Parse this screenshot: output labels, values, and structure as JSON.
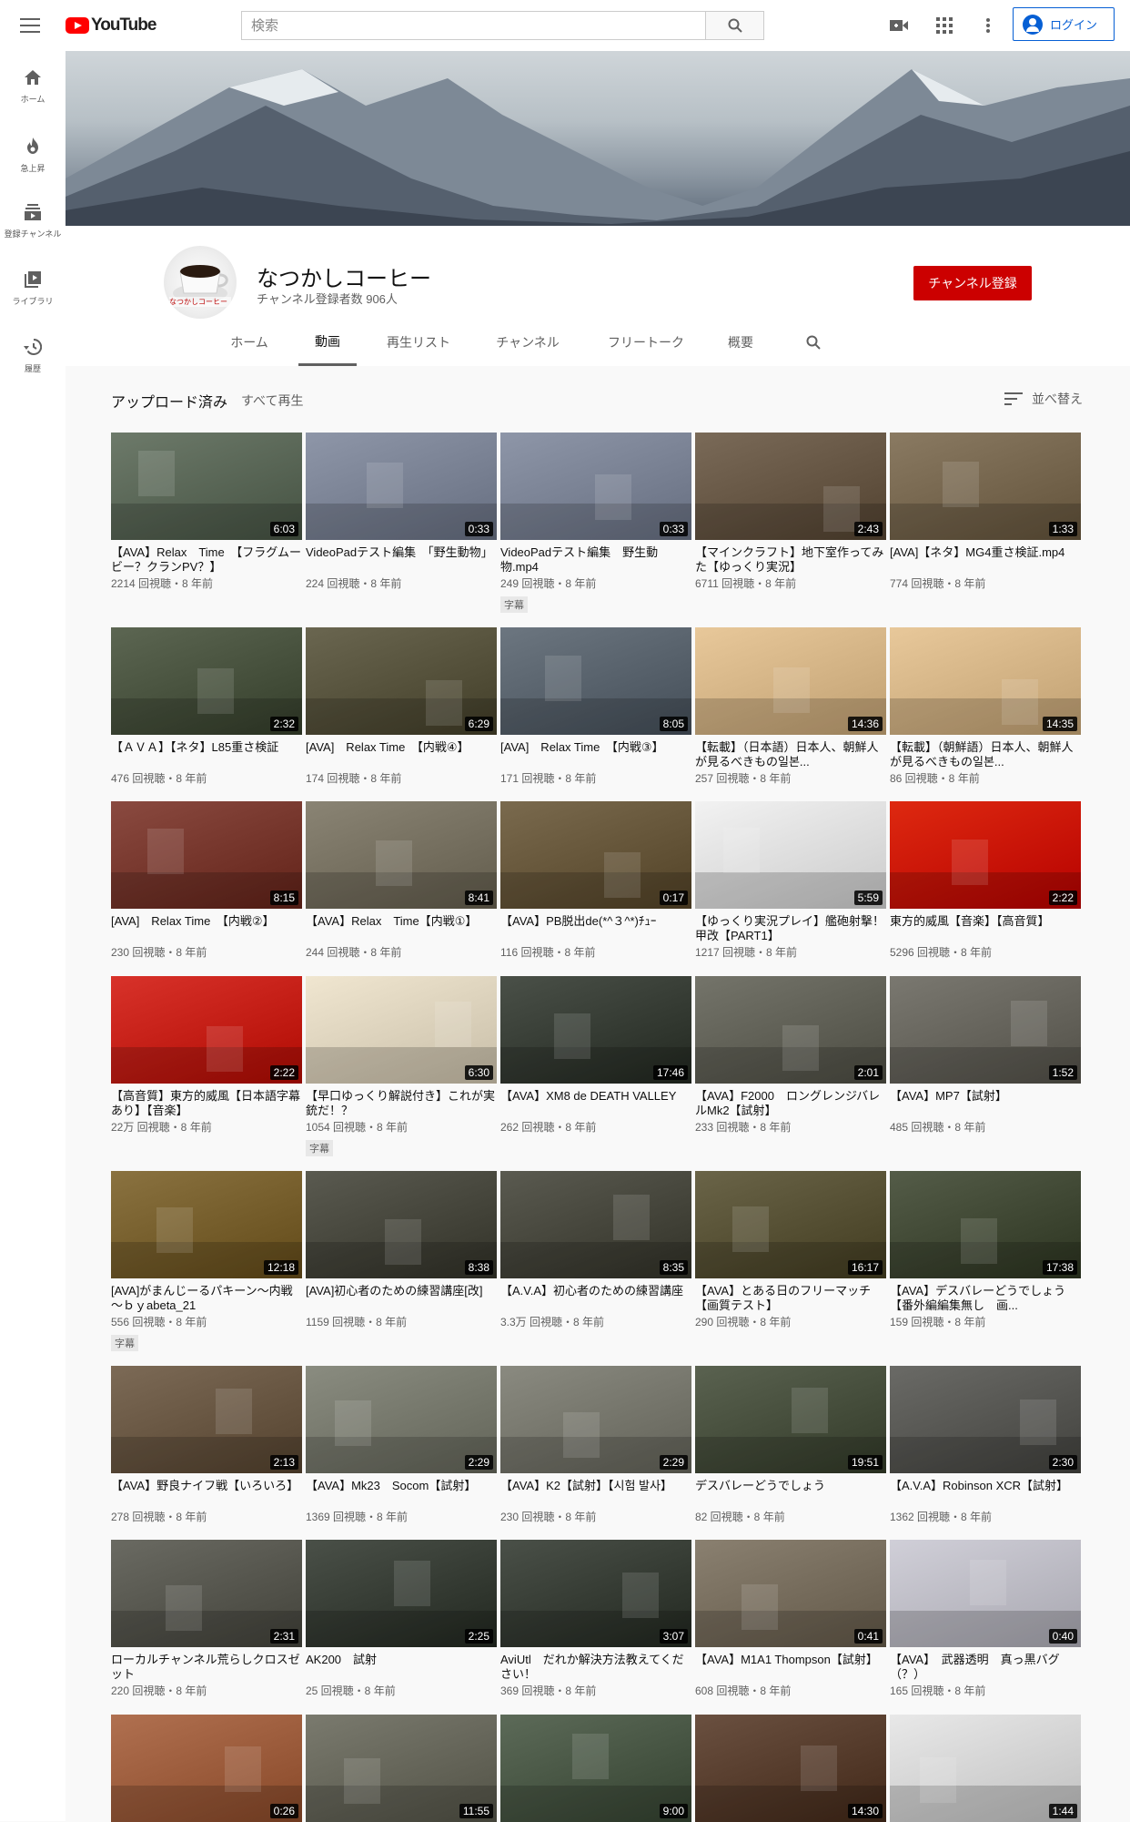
{
  "header": {
    "logo_text": "YouTube",
    "search_placeholder": "検索",
    "login_label": "ログイン"
  },
  "sidebar": [
    {
      "label": "ホーム",
      "icon": "home-icon"
    },
    {
      "label": "急上昇",
      "icon": "fire-icon"
    },
    {
      "label": "登録チャンネル",
      "icon": "subscriptions-icon"
    },
    {
      "label": "ライブラリ",
      "icon": "library-icon"
    },
    {
      "label": "履歴",
      "icon": "history-icon"
    }
  ],
  "channel": {
    "name": "なつかしコーヒー",
    "subscribers": "チャンネル登録者数 906人",
    "subscribe_label": "チャンネル登録",
    "avatar_text": "なつかしコーヒー"
  },
  "tabs": [
    "ホーム",
    "動画",
    "再生リスト",
    "チャンネル",
    "フリートーク",
    "概要"
  ],
  "active_tab": 1,
  "section": {
    "title": "アップロード済み",
    "play_all": "すべて再生",
    "sort_label": "並べ替え"
  },
  "colors": {
    "accent": "#cc0000",
    "link": "#065fd4"
  },
  "videos": [
    {
      "title": "【AVA】Relax　Time　【フラグムービー？クランPV？】",
      "meta": "2214 回視聴・8 年前",
      "duration": "6:03",
      "badge": "",
      "bg": "#6d7a6a"
    },
    {
      "title": "VideoPadテスト編集　「野生動物」",
      "meta": "224 回視聴・8 年前",
      "duration": "0:33",
      "badge": "",
      "bg": "#8e96a8"
    },
    {
      "title": "VideoPadテスト編集　野生動物.mp4",
      "meta": "249 回視聴・8 年前",
      "duration": "0:33",
      "badge": "字幕",
      "bg": "#8e96a8"
    },
    {
      "title": "【マインクラフト】地下室作ってみた【ゆっくり実況】",
      "meta": "6711 回視聴・8 年前",
      "duration": "2:43",
      "badge": "",
      "bg": "#7a6a58"
    },
    {
      "title": "[AVA]【ネタ】MG4重さ検証.mp4",
      "meta": "774 回視聴・8 年前",
      "duration": "1:33",
      "badge": "",
      "bg": "#8a7a62"
    },
    {
      "title": "【ＡＶＡ】【ネタ】L85重さ検証",
      "meta": "476 回視聴・8 年前",
      "duration": "2:32",
      "badge": "",
      "bg": "#5c6652"
    },
    {
      "title": "[AVA]　Relax Time　【内戦④】",
      "meta": "174 回視聴・8 年前",
      "duration": "6:29",
      "badge": "",
      "bg": "#6a6650"
    },
    {
      "title": "[AVA]　Relax Time　【内戦③】",
      "meta": "171 回視聴・8 年前",
      "duration": "8:05",
      "badge": "",
      "bg": "#6c7680"
    },
    {
      "title": "【転載】（日本語）日本人、朝鮮人が見るべきもの일본...",
      "meta": "257 回視聴・8 年前",
      "duration": "14:36",
      "badge": "",
      "bg": "#e8c89a"
    },
    {
      "title": "【転載】（朝鮮語）日本人、朝鮮人が見るべきもの일본...",
      "meta": "86 回視聴・8 年前",
      "duration": "14:35",
      "badge": "",
      "bg": "#e8c89a"
    },
    {
      "title": "[AVA]　Relax Time　【内戦②】",
      "meta": "230 回視聴・8 年前",
      "duration": "8:15",
      "badge": "",
      "bg": "#8a4a40"
    },
    {
      "title": "【AVA】Relax　Time【内戦①】",
      "meta": "244 回視聴・8 年前",
      "duration": "8:41",
      "badge": "",
      "bg": "#8a8474"
    },
    {
      "title": "【AVA】PB脱出de(*^３^*)ﾁｭｰ",
      "meta": "116 回視聴・8 年前",
      "duration": "0:17",
      "badge": "",
      "bg": "#7a6a4e"
    },
    {
      "title": "【ゆっくり実況プレイ】艦砲射撃！甲改【PART1】",
      "meta": "1217 回視聴・8 年前",
      "duration": "5:59",
      "badge": "",
      "bg": "#f2f2f2"
    },
    {
      "title": "東方的威風【音楽】【高音質】",
      "meta": "5296 回視聴・8 年前",
      "duration": "2:22",
      "badge": "",
      "bg": "#de2910"
    },
    {
      "title": "【高音質】東方的威風【日本語字幕あり】【音楽】",
      "meta": "22万 回視聴・8 年前",
      "duration": "2:22",
      "badge": "",
      "bg": "#d8322a"
    },
    {
      "title": "【早口ゆっくり解説付き】これが実銃だ！？",
      "meta": "1054 回視聴・8 年前",
      "duration": "6:30",
      "badge": "字幕",
      "bg": "#f0e6d0"
    },
    {
      "title": "【AVA】XM8 de DEATH VALLEY",
      "meta": "262 回視聴・8 年前",
      "duration": "17:46",
      "badge": "",
      "bg": "#4a5048"
    },
    {
      "title": "【AVA】F2000　ロングレンジバレルMk2【試射】",
      "meta": "233 回視聴・8 年前",
      "duration": "2:01",
      "badge": "",
      "bg": "#74746a"
    },
    {
      "title": "【AVA】MP7【試射】",
      "meta": "485 回視聴・8 年前",
      "duration": "1:52",
      "badge": "",
      "bg": "#7a7870"
    },
    {
      "title": "[AVA]がまんじーるパキーン～内戦～ｂｙabeta_21",
      "meta": "556 回視聴・8 年前",
      "duration": "12:18",
      "badge": "字幕",
      "bg": "#8a7240"
    },
    {
      "title": "[AVA]初心者のための練習講座[改]",
      "meta": "1159 回視聴・8 年前",
      "duration": "8:38",
      "badge": "",
      "bg": "#5a5a50"
    },
    {
      "title": "【A.V.A】初心者のための練習講座",
      "meta": "3.3万 回視聴・8 年前",
      "duration": "8:35",
      "badge": "",
      "bg": "#5a5a50"
    },
    {
      "title": "【AVA】とある日のフリーマッチ【画質テスト】",
      "meta": "290 回視聴・8 年前",
      "duration": "16:17",
      "badge": "",
      "bg": "#6a6448"
    },
    {
      "title": "【AVA】デスバレーどうでしょう【番外編編集無し　画...",
      "meta": "159 回視聴・8 年前",
      "duration": "17:38",
      "badge": "",
      "bg": "#545c48"
    },
    {
      "title": "【AVA】野良ナイフ戦【いろいろ】",
      "meta": "278 回視聴・8 年前",
      "duration": "2:13",
      "badge": "",
      "bg": "#7c6a56"
    },
    {
      "title": "【AVA】Mk23　Socom【試射】",
      "meta": "1369 回視聴・8 年前",
      "duration": "2:29",
      "badge": "",
      "bg": "#8a8c80"
    },
    {
      "title": "【AVA】K2【試射】【시험 발사】",
      "meta": "230 回視聴・8 年前",
      "duration": "2:29",
      "badge": "",
      "bg": "#8a8a80"
    },
    {
      "title": "デスバレーどうでしょう",
      "meta": "82 回視聴・8 年前",
      "duration": "19:51",
      "badge": "",
      "bg": "#5a6250"
    },
    {
      "title": "【A.V.A】Robinson XCR【試射】",
      "meta": "1362 回視聴・8 年前",
      "duration": "2:30",
      "badge": "",
      "bg": "#6a6a66"
    },
    {
      "title": "ローカルチャンネル荒らしクロスゼット",
      "meta": "220 回視聴・8 年前",
      "duration": "2:31",
      "badge": "",
      "bg": "#6a6a62"
    },
    {
      "title": "AK200　試射",
      "meta": "25 回視聴・8 年前",
      "duration": "2:25",
      "badge": "",
      "bg": "#4a5048"
    },
    {
      "title": "AviUtl　だれか解決方法教えてください！",
      "meta": "369 回視聴・8 年前",
      "duration": "3:07",
      "badge": "",
      "bg": "#4a5048"
    },
    {
      "title": "【AVA】M1A1 Thompson【試射】",
      "meta": "608 回視聴・8 年前",
      "duration": "0:41",
      "badge": "",
      "bg": "#8a8070"
    },
    {
      "title": "【AVA】　武器透明　真っ黒バグ（？）",
      "meta": "165 回視聴・8 年前",
      "duration": "0:40",
      "badge": "",
      "bg": "#d0cfd8"
    },
    {
      "title": "",
      "meta": "",
      "duration": "0:26",
      "badge": "",
      "bg": "#b07050"
    },
    {
      "title": "",
      "meta": "",
      "duration": "11:55",
      "badge": "",
      "bg": "#7a7a6e"
    },
    {
      "title": "",
      "meta": "",
      "duration": "9:00",
      "badge": "",
      "bg": "#5c6a58"
    },
    {
      "title": "",
      "meta": "",
      "duration": "14:30",
      "badge": "",
      "bg": "#6a5040"
    },
    {
      "title": "",
      "meta": "",
      "duration": "1:44",
      "badge": "",
      "bg": "#e8e8e8"
    }
  ]
}
